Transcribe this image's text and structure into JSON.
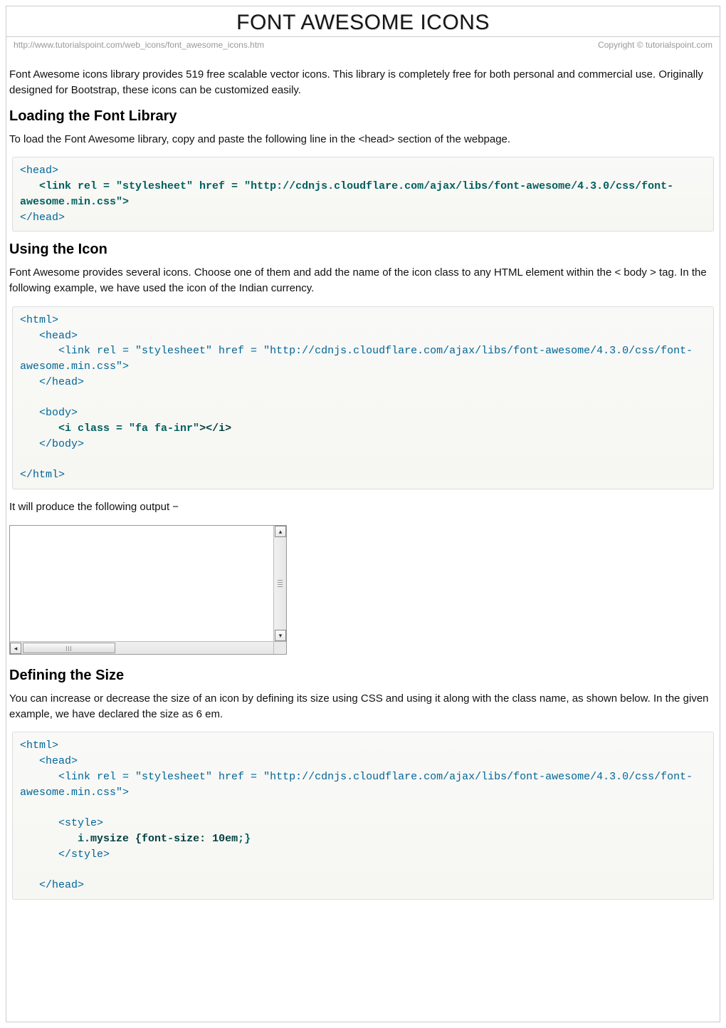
{
  "header": {
    "title": "FONT AWESOME ICONS",
    "url": "http://www.tutorialspoint.com/web_icons/font_awesome_icons.htm",
    "copyright": "Copyright © tutorialspoint.com"
  },
  "intro": "Font Awesome icons library provides 519 free scalable vector icons. This library is completely free for both personal and commercial use. Originally designed for Bootstrap, these icons can be customized easily.",
  "sections": {
    "loading": {
      "heading": "Loading the Font Library",
      "text": "To load the Font Awesome library, copy and paste the following line in the <head> section of the webpage.",
      "code_open": "<head>",
      "code_bold": "   <link rel = \"stylesheet\" href = \"http://cdnjs.cloudflare.com/ajax/libs/font-awesome/4.3.0/css/font-awesome.min.css\">",
      "code_close": "</head>"
    },
    "using": {
      "heading": "Using the Icon",
      "text": "Font Awesome provides several icons. Choose one of them and add the name of the icon class to any HTML element within the < body > tag. In the following example, we have used the icon of the Indian currency.",
      "code_l1": "<html>",
      "code_l2": "   <head>",
      "code_l3": "      <link rel = \"stylesheet\" href = \"http://cdnjs.cloudflare.com/ajax/libs/font-awesome/4.3.0/css/font-awesome.min.css\">",
      "code_l4": "   </head>",
      "code_l5": "",
      "code_l6": "   <body>",
      "code_l7_a": "      <i class = \"fa fa-inr\"",
      "code_l7_b": "></i>",
      "code_l8": "   </body>",
      "code_l9": "",
      "code_l10": "</html>",
      "output_text": "It will produce the following output −"
    },
    "defining": {
      "heading": "Defining the Size",
      "text": "You can increase or decrease the size of an icon by defining its size using CSS and using it along with the class name, as shown below. In the given example, we have declared the size as 6 em.",
      "code_l1": "<html>",
      "code_l2": "   <head>",
      "code_l3": "      <link rel = \"stylesheet\" href = \"http://cdnjs.cloudflare.com/ajax/libs/font-awesome/4.3.0/css/font-awesome.min.css\">",
      "code_l4": "",
      "code_l5": "      <style>",
      "code_l6_a": "         i",
      "code_l6_b": ".mysize {font",
      "code_l6_c": "-",
      "code_l6_d": "size: 10em",
      "code_l6_e": ";}",
      "code_l7": "      </style>",
      "code_l8": "",
      "code_l9": "   </head>"
    }
  }
}
